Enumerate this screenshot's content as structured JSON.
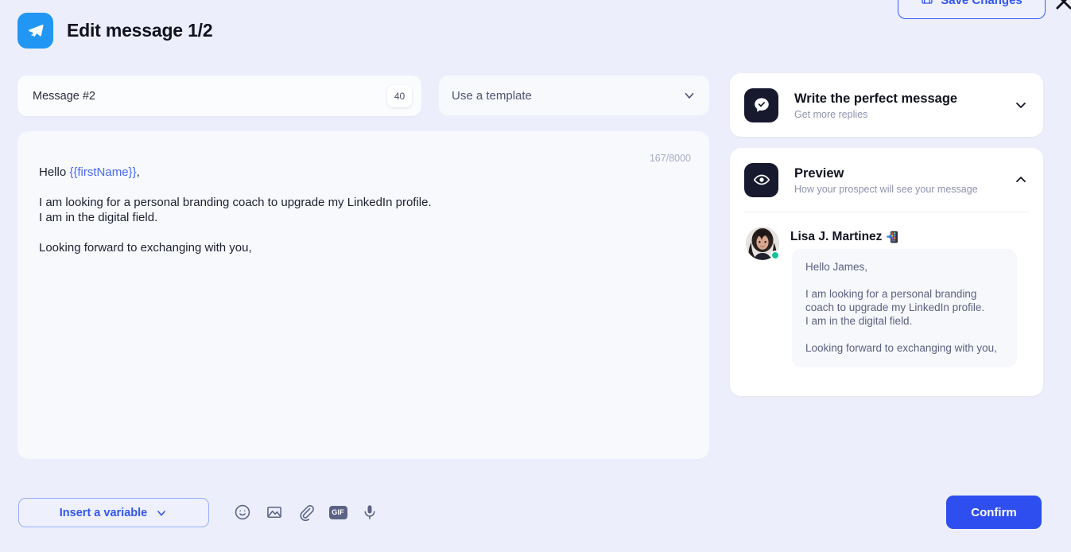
{
  "header": {
    "logo_icon": "paper-plane-icon",
    "logo_color": "#2196f3",
    "title": "Edit message 1/2",
    "save_button_label": "Save Changes",
    "save_button_icon": "save-floppy-icon",
    "close_icon": "close-x-icon"
  },
  "editor": {
    "message_name": "Message #2",
    "message_name_counter": "40",
    "template_placeholder": "Use a template",
    "template_chevron_icon": "chevron-down-icon",
    "char_counter": "167/8000",
    "body_greeting_prefix": "Hello ",
    "body_variable": "{{firstName}}",
    "body_after_variable": ",",
    "body_rest": "\n\nI am looking for a personal branding coach to upgrade my LinkedIn profile.\nI am in the digital field.\n\nLooking forward to exchanging with you,"
  },
  "toolbar": {
    "insert_variable_label": "Insert a variable",
    "insert_variable_chevron_icon": "chevron-down-icon",
    "icons": [
      {
        "name": "emoji-icon",
        "label": "Emoji"
      },
      {
        "name": "image-icon",
        "label": "Image"
      },
      {
        "name": "attachment-paperclip-icon",
        "label": "Attachment"
      },
      {
        "name": "gif-icon",
        "label": "GIF"
      },
      {
        "name": "microphone-icon",
        "label": "Voice note"
      }
    ],
    "gif_chip_label": "GIF",
    "confirm_label": "Confirm",
    "confirm_color": "#2f4ef0"
  },
  "sidebar": {
    "cards": [
      {
        "id": "write-perfect-message",
        "icon": "chat-check-icon",
        "title": "Write the perfect message",
        "subtitle": "Get more replies",
        "chevron_icon": "chevron-down-icon",
        "expanded": false
      },
      {
        "id": "preview",
        "icon": "eye-icon",
        "title": "Preview",
        "subtitle": "How your prospect will see your message",
        "chevron_icon": "chevron-up-icon",
        "expanded": true
      }
    ]
  },
  "preview": {
    "avatar_name": "avatar",
    "status": "online",
    "status_color": "#15c39a",
    "name": "Lisa J. Martinez",
    "name_badge_icon": "linkedin-open-to-work-badge-icon",
    "message": "Hello James,\n\nI am looking for a personal branding\ncoach to upgrade my LinkedIn profile.\nI am in the digital field.\n\nLooking forward to exchanging with you,"
  }
}
